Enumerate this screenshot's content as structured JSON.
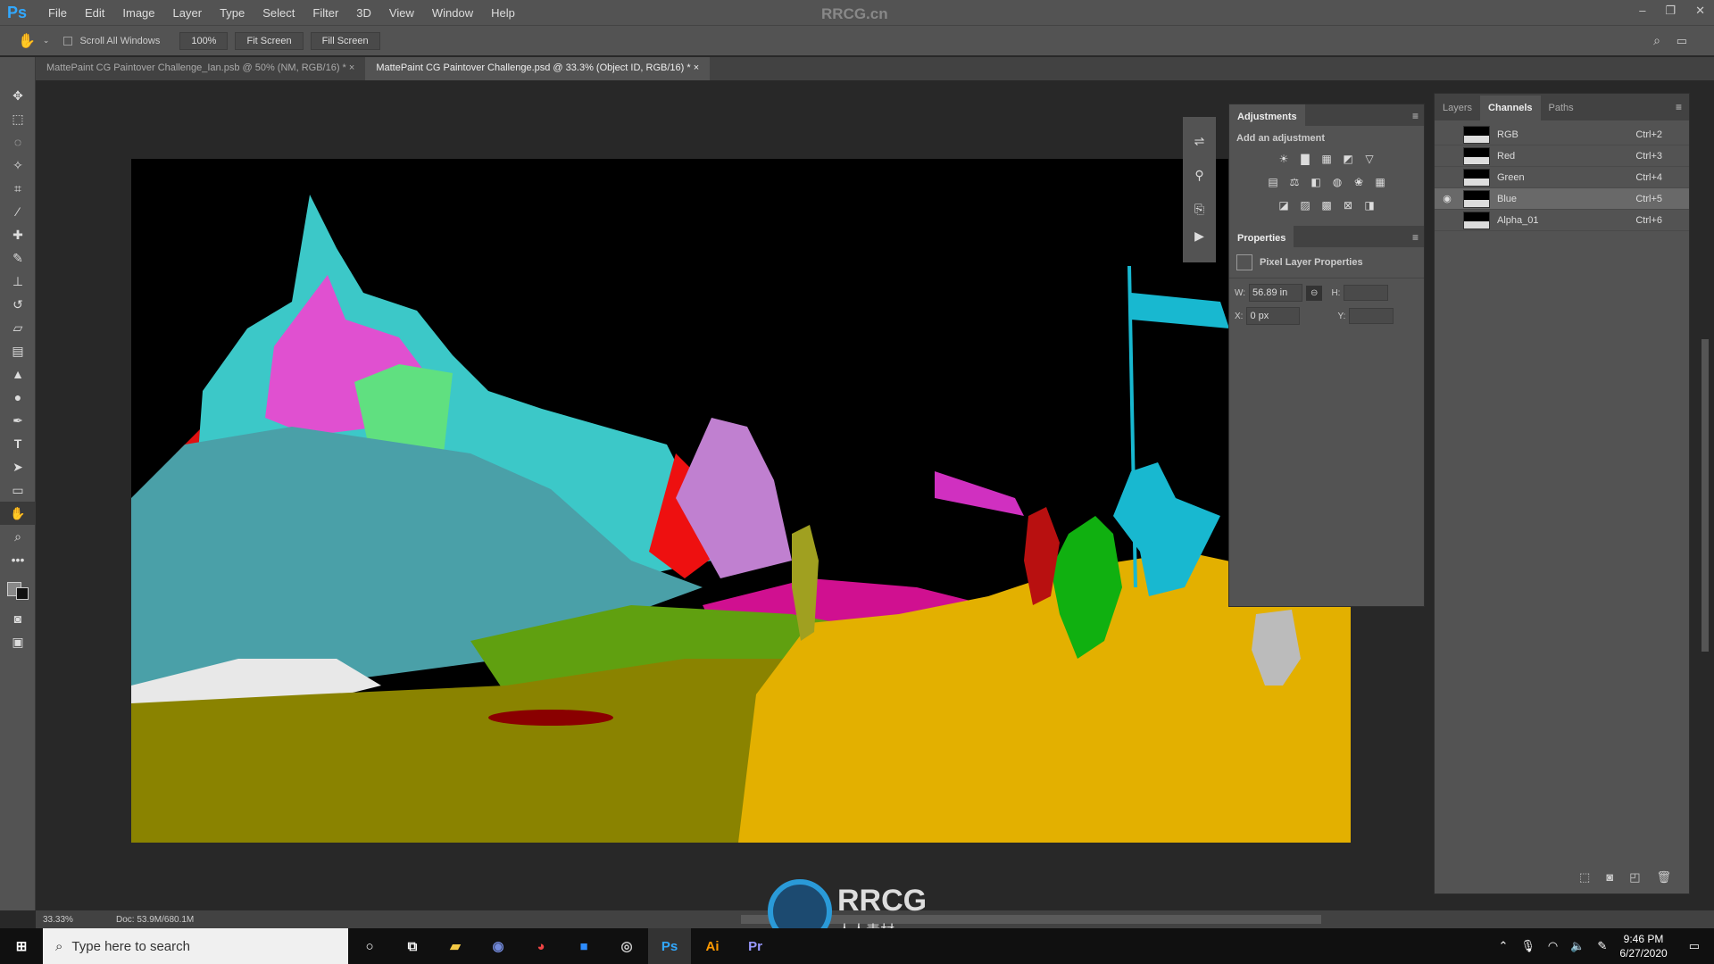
{
  "app": {
    "logo": "Ps",
    "watermark": "RRCG.cn",
    "window_controls": [
      "–",
      "❐",
      "✕"
    ]
  },
  "menu": [
    "File",
    "Edit",
    "Image",
    "Layer",
    "Type",
    "Select",
    "Filter",
    "3D",
    "View",
    "Window",
    "Help"
  ],
  "options": {
    "scroll_all_windows": "Scroll All Windows",
    "zoom": "100%",
    "fit_screen": "Fit Screen",
    "fill_screen": "Fill Screen"
  },
  "tabs": [
    {
      "label": "MattePaint CG Paintover Challenge_Ian.psb @ 50% (NM, RGB/16) *",
      "close": "×"
    },
    {
      "label": "MattePaint CG Paintover Challenge.psd @ 33.3% (Object ID, RGB/16) *",
      "close": "×"
    }
  ],
  "tools": [
    "move",
    "marquee",
    "lasso",
    "magic-wand",
    "crop",
    "eyedropper",
    "healing",
    "brush",
    "stamp",
    "history-brush",
    "eraser",
    "gradient",
    "blur",
    "dodge",
    "pen",
    "type",
    "path-select",
    "rectangle",
    "hand",
    "zoom",
    "more"
  ],
  "adjustments": {
    "title": "Adjustments",
    "subtitle": "Add an adjustment"
  },
  "properties": {
    "title": "Properties",
    "header": "Pixel Layer Properties",
    "w_label": "W:",
    "w_value": "56.89 in",
    "h_label": "H:",
    "x_label": "X:",
    "x_value": "0 px",
    "y_label": "Y:"
  },
  "channels_panel": {
    "tabs": [
      "Layers",
      "Channels",
      "Paths"
    ],
    "active_tab": "Channels",
    "rows": [
      {
        "name": "RGB",
        "shortcut": "Ctrl+2",
        "visible": false
      },
      {
        "name": "Red",
        "shortcut": "Ctrl+3",
        "visible": false
      },
      {
        "name": "Green",
        "shortcut": "Ctrl+4",
        "visible": false
      },
      {
        "name": "Blue",
        "shortcut": "Ctrl+5",
        "visible": true
      },
      {
        "name": "Alpha_01",
        "shortcut": "Ctrl+6",
        "visible": false
      }
    ]
  },
  "status": {
    "zoom": "33.33%",
    "doc": "Doc: 53.9M/680.1M"
  },
  "taskbar": {
    "search_placeholder": "Type here to search",
    "time": "9:46 PM",
    "date": "6/27/2020",
    "apps": [
      "Ps",
      "Ai",
      "Pr"
    ]
  },
  "overlay_logo": {
    "text": "RRCG",
    "subtext": "人人素材"
  },
  "colors": {
    "accent": "#31a8ff",
    "canvas_bg": "#000000",
    "ground": "#e3b000",
    "field": "#8a8300"
  }
}
